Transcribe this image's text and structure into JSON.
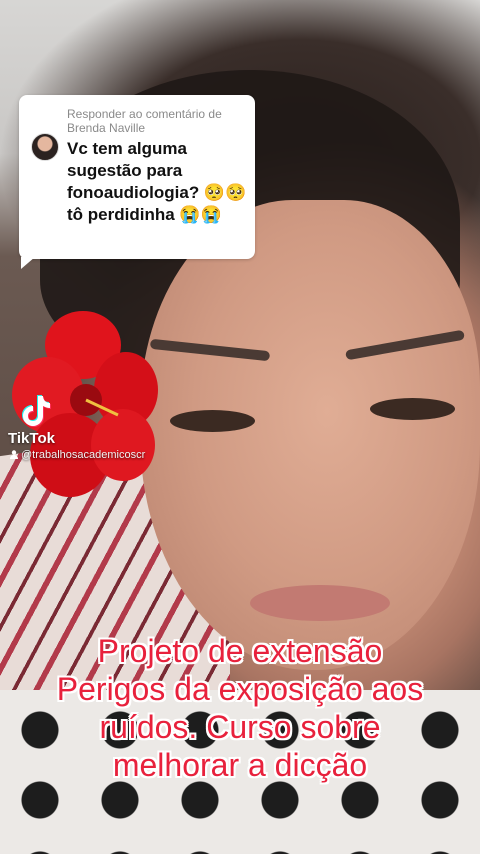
{
  "reply_card": {
    "title": "Responder ao comentário de Brenda Naville",
    "comment": "Vc tem alguma sugestão para fonoaudiologia? 🥺🥺 tô perdidinha 😭😭"
  },
  "watermark": {
    "brand": "TikTok",
    "handle": "@trabalhosacademicoscr"
  },
  "caption": {
    "lines": [
      "Projeto de extensão",
      "Perigos da exposição aos",
      "ruídos. Curso sobre",
      "melhorar a dicção"
    ]
  },
  "colors": {
    "caption_text": "#e8213c",
    "caption_outline": "#ffffff",
    "card_bg": "#ffffff"
  },
  "icons": [
    "tiktok-logo-icon",
    "user-icon",
    "avatar"
  ]
}
